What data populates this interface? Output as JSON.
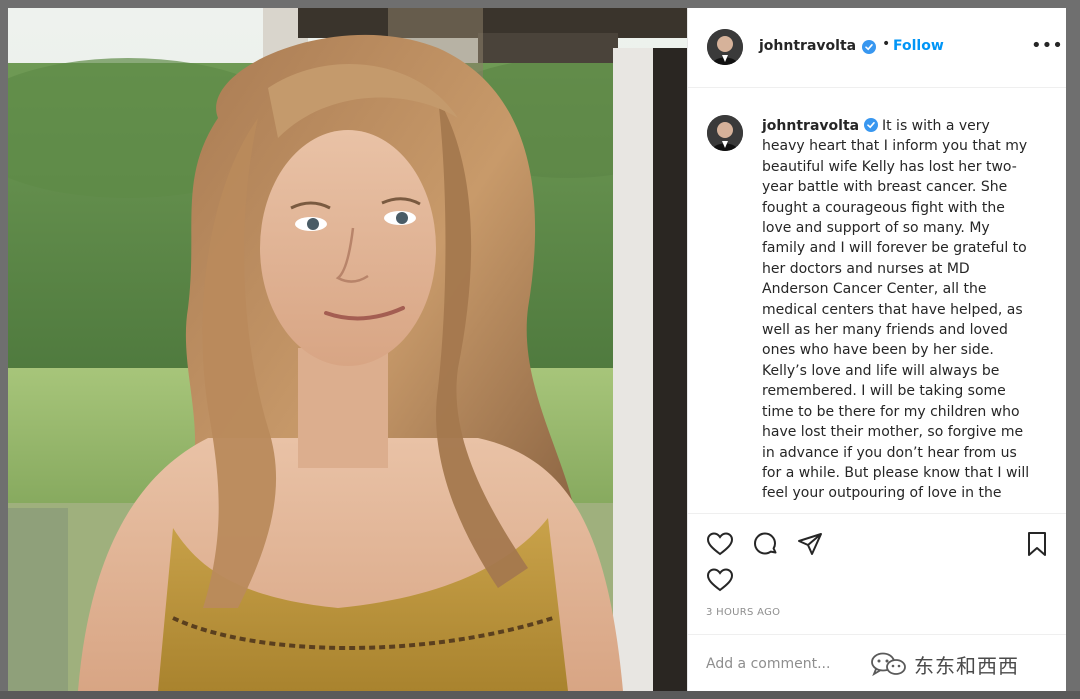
{
  "post": {
    "header": {
      "username": "johntravolta",
      "separator": "•",
      "follow_label": "Follow",
      "more_label": "•••"
    },
    "caption": {
      "username": "johntravolta",
      "text": "It is with a very heavy heart that I inform you that my beautiful wife Kelly has lost her two-year battle with breast cancer. She fought a courageous fight with the love and support of so many.  My family and I will forever be grateful to her doctors and nurses at MD Anderson Cancer Center, all the medical centers that have helped, as well as her many friends and loved ones who have been by her side. Kelly’s love and life will always be remembered. I will be taking some time to be there for my children who have lost their mother, so forgive me in advance if you don’t hear from us for a while.  But please know that I will feel your outpouring of love in the"
    },
    "timestamp": "3 HOURS AGO",
    "comment_placeholder": "Add a comment...",
    "icons": {
      "like": "heart-icon",
      "comment": "comment-bubble-icon",
      "share": "paper-plane-icon",
      "save": "bookmark-icon",
      "verified": "verified-badge-icon"
    },
    "colors": {
      "link_blue": "#0095f6",
      "text": "#262626",
      "muted": "#8e8e8e",
      "verified": "#3897f0"
    }
  },
  "watermark": {
    "text": "东东和西西"
  }
}
